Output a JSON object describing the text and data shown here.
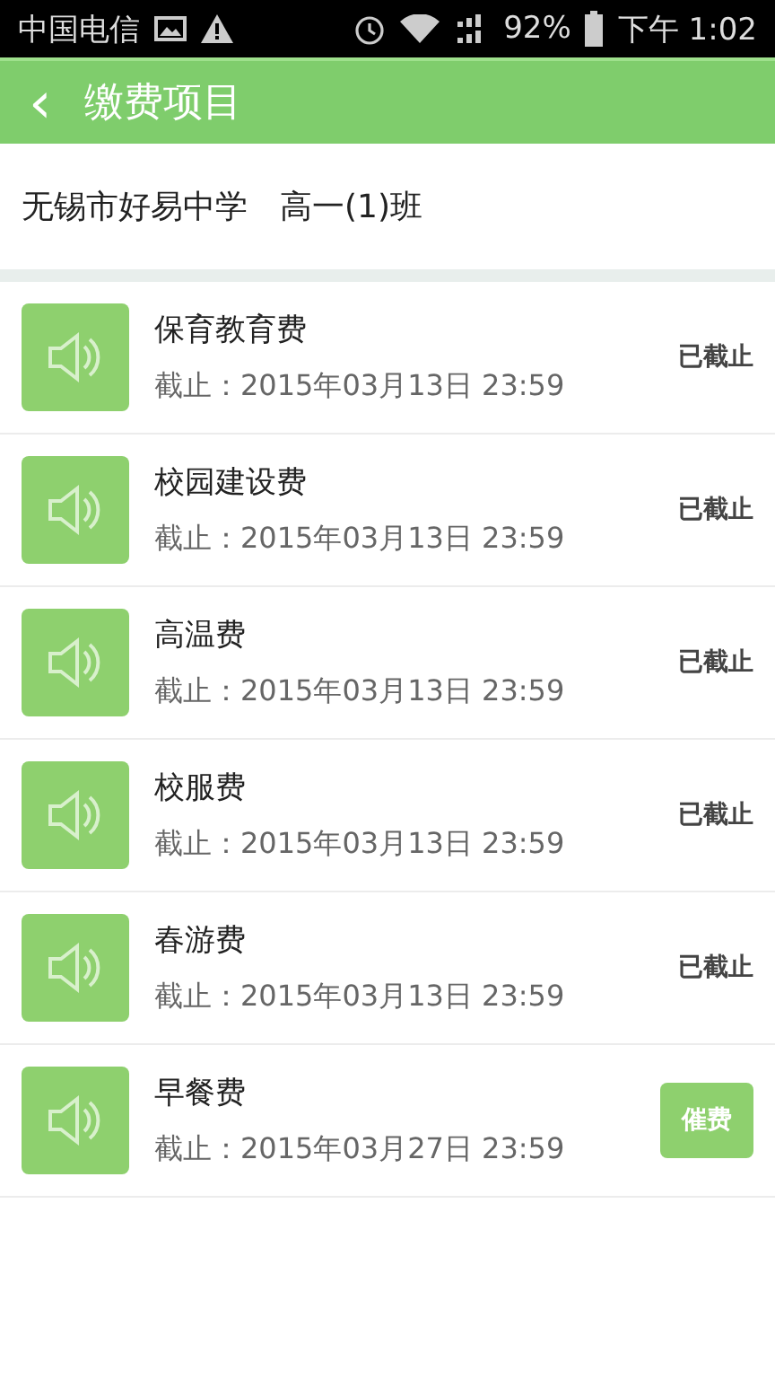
{
  "status_bar": {
    "carrier": "中国电信",
    "battery": "92%",
    "time": "下午 1:02"
  },
  "header": {
    "back": "‹",
    "title": "缴费项目"
  },
  "class_info": "无锡市好易中学　高一(1)班",
  "items": [
    {
      "name": "保育教育费",
      "deadline": "截止：2015年03月13日  23:59",
      "kind": "expired",
      "status": "已截止"
    },
    {
      "name": "校园建设费",
      "deadline": "截止：2015年03月13日  23:59",
      "kind": "expired",
      "status": "已截止"
    },
    {
      "name": "高温费",
      "deadline": "截止：2015年03月13日  23:59",
      "kind": "expired",
      "status": "已截止"
    },
    {
      "name": "校服费",
      "deadline": "截止：2015年03月13日  23:59",
      "kind": "expired",
      "status": "已截止"
    },
    {
      "name": "春游费",
      "deadline": "截止：2015年03月13日  23:59",
      "kind": "expired",
      "status": "已截止"
    },
    {
      "name": "早餐费",
      "deadline": "截止：2015年03月27日  23:59",
      "kind": "button",
      "status": "催费"
    }
  ]
}
